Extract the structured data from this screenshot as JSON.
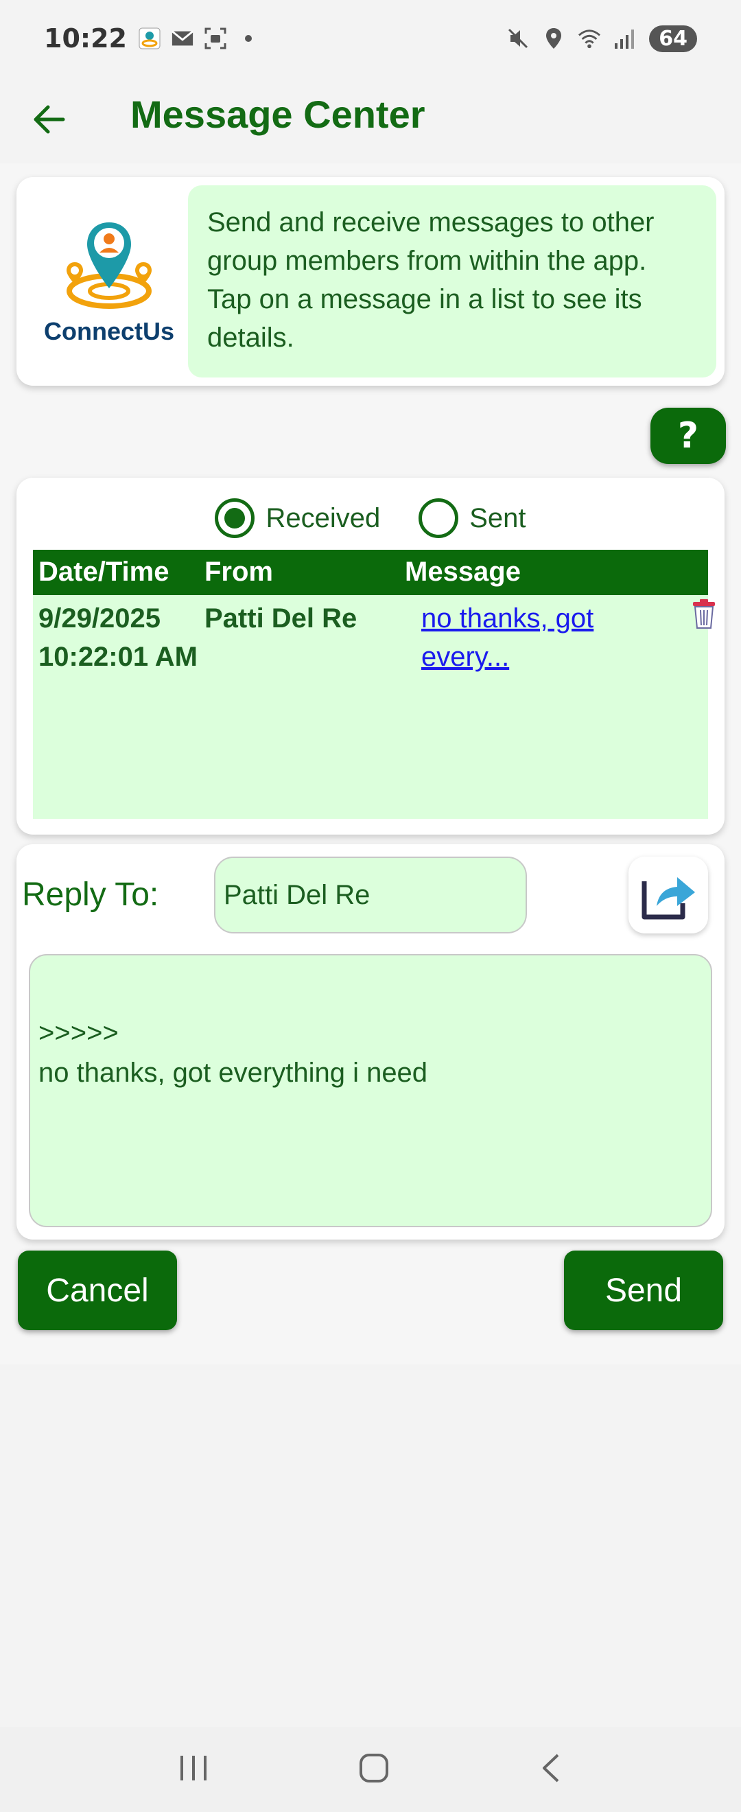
{
  "status_bar": {
    "time": "10:22",
    "battery": "64",
    "icons_left": [
      "app-notification-icon",
      "mail-icon",
      "screenshot-icon",
      "dot-icon"
    ],
    "icons_right": [
      "mute-icon",
      "location-icon",
      "wifi-icon",
      "signal-icon"
    ]
  },
  "app_bar": {
    "title": "Message Center"
  },
  "intro": {
    "logo_text": "ConnectUs",
    "text": "Send and receive messages to other group members from within the app. Tap on a message in a list to see its details."
  },
  "help_button": {
    "label": "?"
  },
  "message_filter": {
    "options": [
      {
        "label": "Received",
        "selected": true
      },
      {
        "label": "Sent",
        "selected": false
      }
    ]
  },
  "table": {
    "headers": [
      "Date/Time",
      "From",
      "Message"
    ],
    "rows": [
      {
        "date": "9/29/2025",
        "time": "10:22:01 AM",
        "from": "Patti Del Re",
        "message_line1": "no thanks, got",
        "message_line2": "every..."
      }
    ]
  },
  "reply": {
    "label": "Reply To:",
    "to_value": "Patti Del Re",
    "body": ">>>>>\nno thanks, got everything i need"
  },
  "actions": {
    "cancel_label": "Cancel",
    "send_label": "Send"
  },
  "colors": {
    "primary": "#0b6a0b",
    "title": "#136b14",
    "light_green": "#dcffdc",
    "link": "#1a1aee"
  }
}
